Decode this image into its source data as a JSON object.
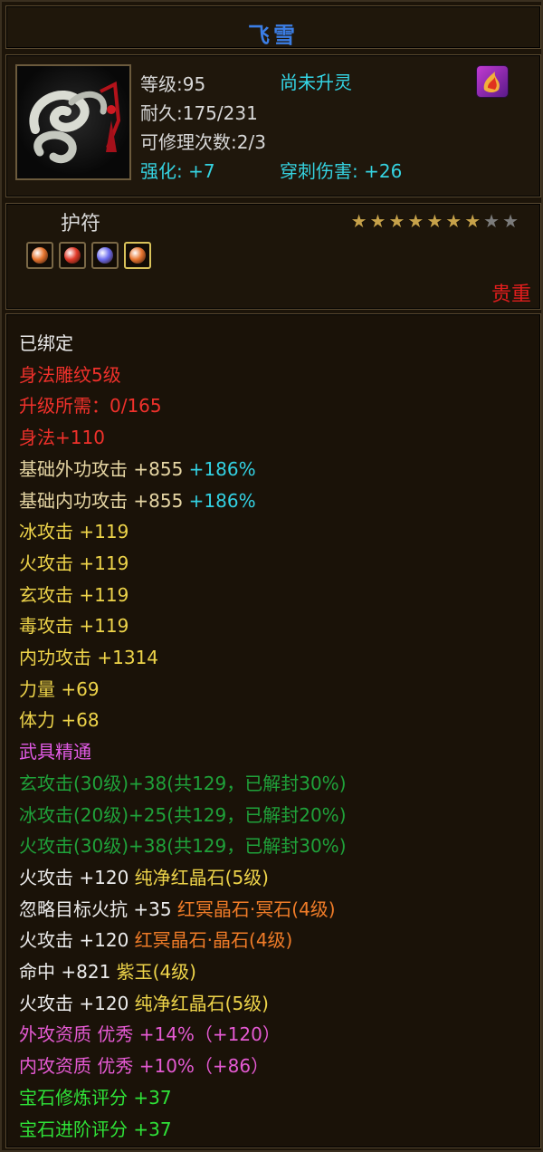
{
  "item": {
    "name": "飞雪",
    "level_text": "等级:95",
    "spirit_status": "尚未升灵",
    "durability_text": "耐久:175/231",
    "repair_text": "可修理次数:2/3",
    "enhance_text": "强化: +7",
    "pierce_text": "穿刺伤害: +26",
    "portrait_icon": "jade-amulet-icon",
    "rebirth_icon": "spirit-flame-icon"
  },
  "category": {
    "label": "护符",
    "stars_filled": 7,
    "stars_total": 9,
    "rarity": "贵重"
  },
  "gems": [
    {
      "name": "gem-slot-1",
      "color": "#e8752f"
    },
    {
      "name": "gem-slot-2",
      "color": "#e23a2a"
    },
    {
      "name": "gem-slot-3",
      "color": "#6c6cf0"
    },
    {
      "name": "gem-slot-4",
      "color": "#e8752f",
      "selected": true
    }
  ],
  "stats": [
    {
      "text": "已绑定",
      "color": "white"
    },
    {
      "text": "身法雕纹5级",
      "color": "red"
    },
    {
      "text": "升级所需：0/165",
      "color": "red"
    },
    {
      "text": "身法+110",
      "color": "red"
    },
    {
      "text": "基础外功攻击 +855",
      "extra": "+186%",
      "color": "tan"
    },
    {
      "text": "基础内功攻击 +855",
      "extra": "+186%",
      "color": "tan"
    },
    {
      "text": "冰攻击 +119",
      "color": "yellow"
    },
    {
      "text": "火攻击 +119",
      "color": "yellow"
    },
    {
      "text": "玄攻击 +119",
      "color": "yellow"
    },
    {
      "text": "毒攻击 +119",
      "color": "yellow"
    },
    {
      "text": "内功攻击 +1314",
      "color": "yellow"
    },
    {
      "text": "力量 +69",
      "color": "yellow"
    },
    {
      "text": "体力 +68",
      "color": "yellow"
    },
    {
      "text": "武具精通",
      "color": "pink"
    },
    {
      "text": "玄攻击(30级)+38(共129，已解封30%)",
      "color": "green"
    },
    {
      "text": "冰攻击(20级)+25(共129，已解封20%)",
      "color": "green"
    },
    {
      "text": "火攻击(30级)+38(共129，已解封30%)",
      "color": "green"
    },
    {
      "text": "火攻击 +120 ",
      "extra": "纯净红晶石(5级)",
      "color": "white",
      "extra_color": "yellow"
    },
    {
      "text": "忽略目标火抗 +35 ",
      "extra": "红冥晶石·冥石(4级)",
      "color": "white",
      "extra_color": "orange"
    },
    {
      "text": "火攻击 +120 ",
      "extra": "红冥晶石·晶石(4级)",
      "color": "white",
      "extra_color": "orange"
    },
    {
      "text": "命中 +821 ",
      "extra": "紫玉(4级)",
      "color": "white",
      "extra_color": "yellow"
    },
    {
      "text": "火攻击 +120 ",
      "extra": "纯净红晶石(5级)",
      "color": "white",
      "extra_color": "yellow"
    },
    {
      "text": "外攻资质  优秀 +14%（+120）",
      "color": "magenta"
    },
    {
      "text": "内攻资质  优秀 +10%（+86）",
      "color": "magenta"
    },
    {
      "text": "宝石修炼评分 +37",
      "color": "bright-green"
    },
    {
      "text": "宝石进阶评分 +37",
      "color": "bright-green"
    }
  ]
}
